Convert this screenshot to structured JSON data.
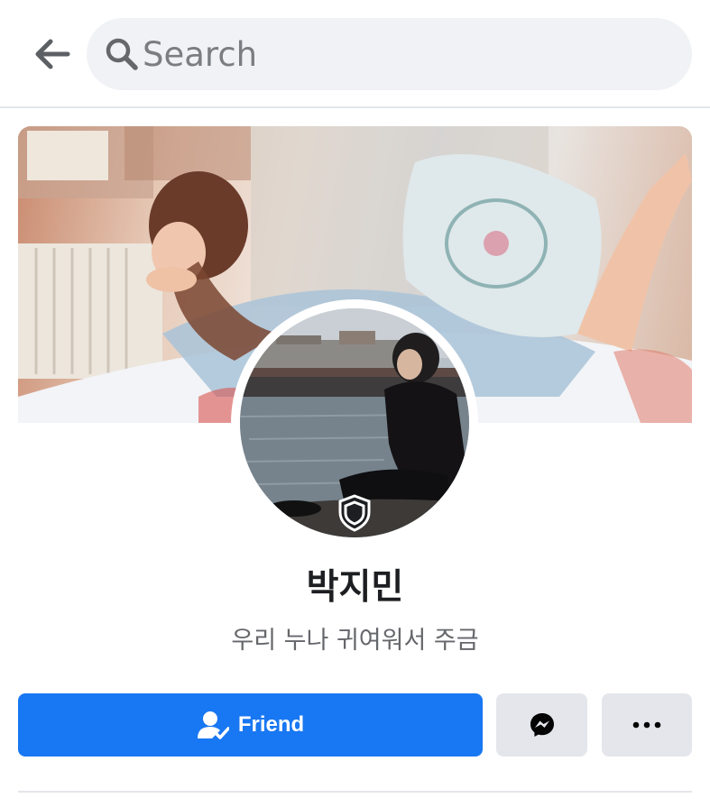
{
  "search": {
    "placeholder": "Search"
  },
  "icons": {
    "back": "arrow-left-icon",
    "search": "magnifier-icon",
    "shield": "shield-icon",
    "friend": "person-check-icon",
    "messenger": "messenger-icon",
    "more": "three-dots-icon"
  },
  "profile": {
    "name": "박지민",
    "bio": "우리 누나 귀여워서 주금"
  },
  "actions": {
    "friend_label": "Friend"
  },
  "colors": {
    "primary": "#1877f2",
    "secondary_button": "#e4e6eb",
    "search_bg": "#f0f2f5",
    "text_primary": "#1c1e21",
    "text_secondary": "#65676b"
  }
}
